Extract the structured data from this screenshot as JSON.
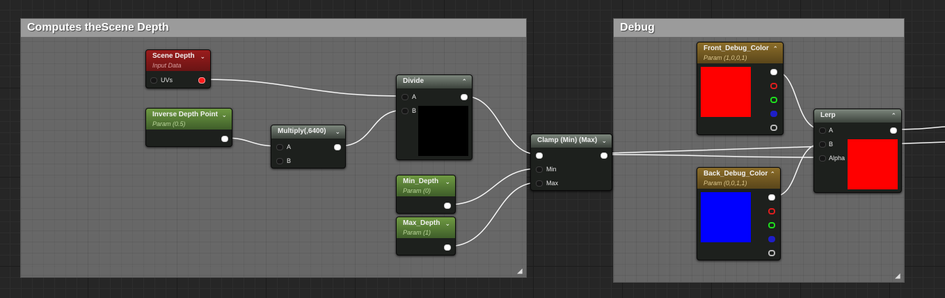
{
  "comments": {
    "scene_depth": {
      "title": "Computes theScene Depth"
    },
    "debug": {
      "title": "Debug"
    }
  },
  "nodes": {
    "scene_depth": {
      "title": "Scene Depth",
      "subtitle": "Input Data",
      "pins": {
        "uvs": "UVs"
      }
    },
    "inverse_depth_point": {
      "title": "Inverse Depth Point",
      "subtitle": "Param (0.5)"
    },
    "multiply": {
      "title": "Multiply(,6400)",
      "pins": {
        "a": "A",
        "b": "B"
      }
    },
    "divide": {
      "title": "Divide",
      "pins": {
        "a": "A",
        "b": "B"
      }
    },
    "min_depth": {
      "title": "Min_Depth",
      "subtitle": "Param (0)"
    },
    "max_depth": {
      "title": "Max_Depth",
      "subtitle": "Param (1)"
    },
    "clamp": {
      "title": "Clamp (Min) (Max)",
      "pins": {
        "min": "Min",
        "max": "Max"
      }
    },
    "front_debug_color": {
      "title": "Front_Debug_Color",
      "subtitle": "Param (1,0,0,1)",
      "preview_color": "#ff0000"
    },
    "back_debug_color": {
      "title": "Back_Debug_Color",
      "subtitle": "Param (0,0,1,1)",
      "preview_color": "#0000ff"
    },
    "lerp": {
      "title": "Lerp",
      "pins": {
        "a": "A",
        "b": "B",
        "alpha": "Alpha"
      },
      "preview_color": "#ff0000"
    }
  },
  "colors": {
    "input_node_header": "#9a1c1c",
    "param_node_header": "#6f9a42",
    "vector_param_header": "#8c6e2a",
    "math_node_header": "#7c867c",
    "wire": "#ffffff"
  }
}
